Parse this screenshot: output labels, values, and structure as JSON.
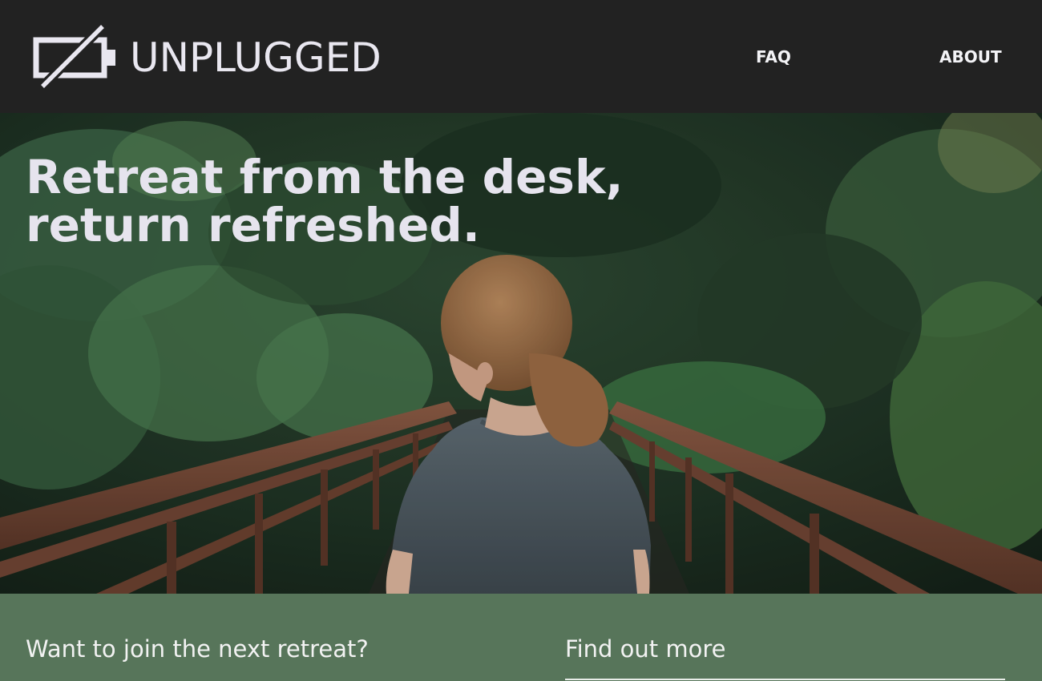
{
  "brand": {
    "name": "UNPLUGGED",
    "icon": "battery-slash-icon"
  },
  "nav": {
    "items": [
      {
        "label": "FAQ"
      },
      {
        "label": "ABOUT"
      }
    ]
  },
  "hero": {
    "title": "Retreat from the desk, return refreshed.",
    "image_subject": "woman-on-forest-bridge"
  },
  "footer": {
    "join_heading": "Want to join the next retreat?",
    "info_heading": "Find out more"
  },
  "colors": {
    "header_bg": "#222222",
    "footer_bg": "#57755a",
    "text_light": "#e9e7f0"
  }
}
